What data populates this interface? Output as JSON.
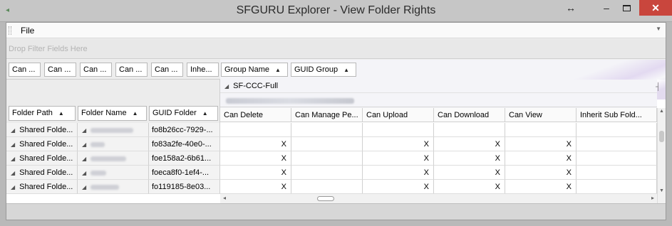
{
  "window": {
    "title": "SFGURU Explorer - View Folder Rights",
    "resize_icon": "↔",
    "minimize_icon": "–",
    "close_icon": "✕"
  },
  "menu": {
    "file": "File"
  },
  "filter": {
    "hint": "Drop Filter Fields Here"
  },
  "data_fields": [
    "Can ...",
    "Can ...",
    "Can ...",
    "Can ...",
    "Can ...",
    "Inhe..."
  ],
  "column_fields": [
    "Group Name",
    "GUID Group"
  ],
  "group": {
    "name": "SF-CCC-Full"
  },
  "row_fields": [
    "Folder Path",
    "Folder Name",
    "GUID Folder"
  ],
  "columns": [
    "Can Delete",
    "Can Manage Pe...",
    "Can Upload",
    "Can Download",
    "Can View",
    "Inherit Sub Fold..."
  ],
  "rows": [
    {
      "path": "Shared Folde...",
      "guid": "fo8b26cc-7929-...",
      "values": [
        "",
        "",
        "",
        "",
        "",
        ""
      ]
    },
    {
      "path": "Shared Folde...",
      "guid": "fo83a2fe-40e0-...",
      "values": [
        "X",
        "",
        "X",
        "X",
        "X",
        ""
      ]
    },
    {
      "path": "Shared Folde...",
      "guid": "foe158a2-6b61...",
      "values": [
        "X",
        "",
        "X",
        "X",
        "X",
        ""
      ]
    },
    {
      "path": "Shared Folde...",
      "guid": "foeca8f0-1ef4-...",
      "values": [
        "X",
        "",
        "X",
        "X",
        "X",
        ""
      ]
    },
    {
      "path": "Shared Folde...",
      "guid": "fo119185-8e03...",
      "values": [
        "X",
        "",
        "X",
        "X",
        "X",
        ""
      ]
    }
  ],
  "colors": {
    "close_button": "#c9463d",
    "titlebar": "#c6c6c6"
  }
}
